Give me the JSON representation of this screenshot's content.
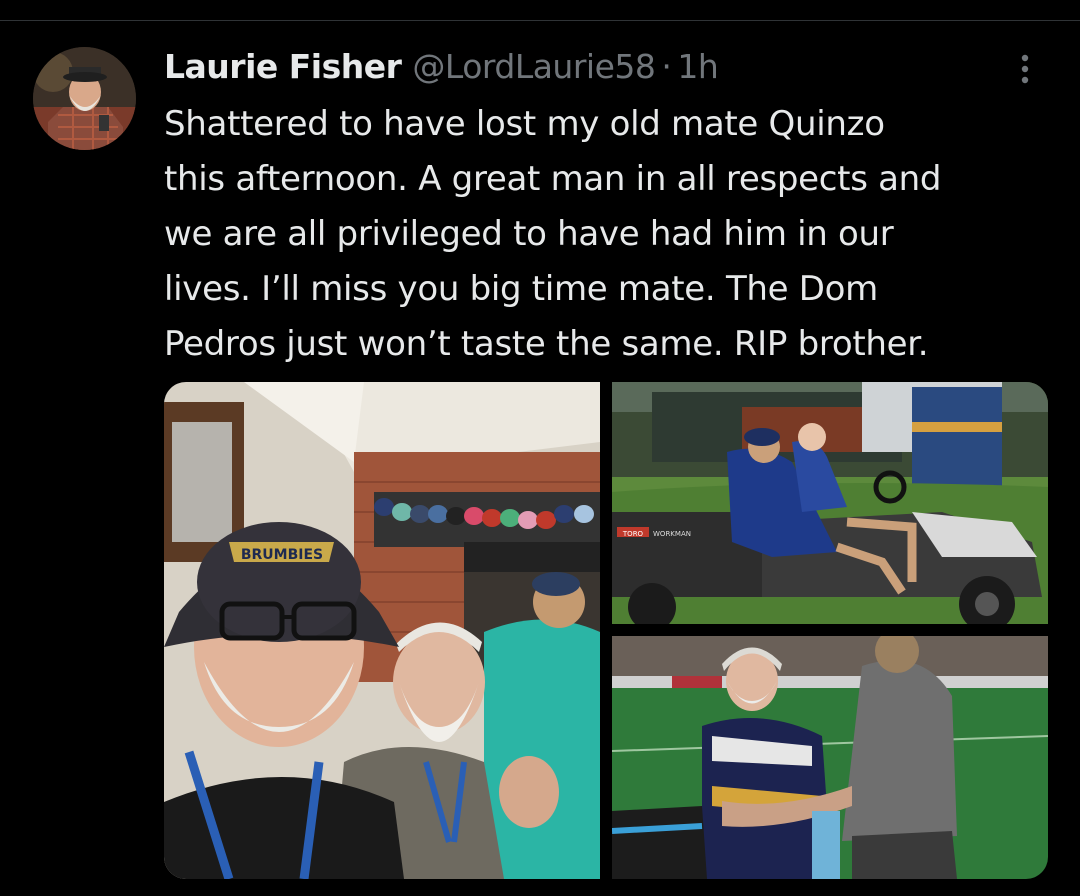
{
  "tweet": {
    "author": {
      "display_name": "Laurie Fisher",
      "handle": "@LordLaurie58"
    },
    "separator": "·",
    "timestamp": "1h",
    "text": "Shattered to have lost my old mate Quinzo\nthis afternoon. A great man in all respects and\nwe are all privileged to have had him in our\nlives. I’ll miss you big time mate. The Dom\nPedros just won’t taste the same. RIP  brother.",
    "media": [
      {
        "kind": "photo",
        "hat_text": "BRUMBIES"
      },
      {
        "kind": "photo",
        "cart_text": [
          "TORO",
          "WORKMAN"
        ]
      },
      {
        "kind": "photo"
      }
    ]
  },
  "icons": {
    "more": "more-vertical-icon"
  }
}
